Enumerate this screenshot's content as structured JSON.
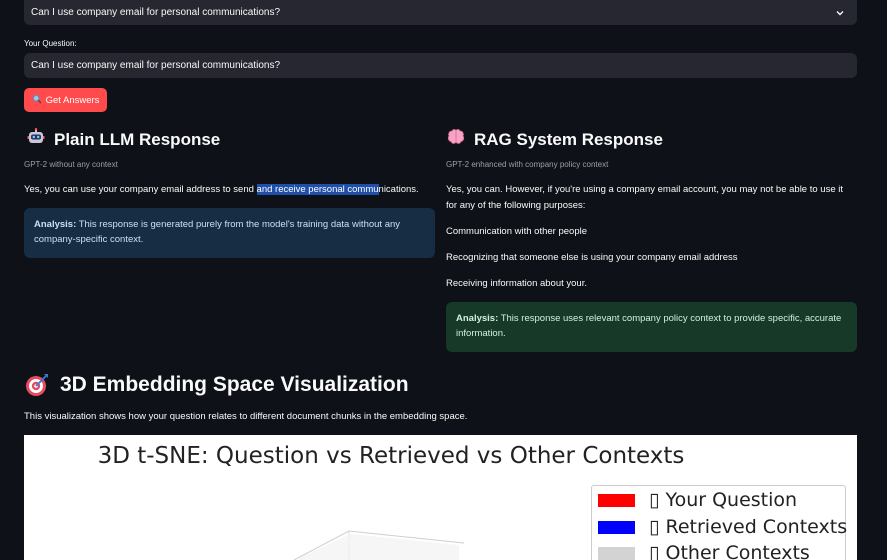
{
  "dropdown": {
    "selected": "Can I use company email for personal communications?"
  },
  "question": {
    "label": "Your Question:",
    "value": "Can I use company email for personal communications?"
  },
  "button": {
    "label": "Get Answers"
  },
  "plain": {
    "title": "Plain LLM Response",
    "caption": "GPT-2 without any context",
    "text_before": "Yes, you can use your company email address to send ",
    "text_highlight": "and receive personal commu",
    "text_after": "nications.",
    "analysis_label": "Analysis:",
    "analysis_text": " This response is generated purely from the model's training data without any company-specific context."
  },
  "rag": {
    "title": "RAG System Response",
    "caption": "GPT-2 enhanced with company policy context",
    "para1": "Yes, you can. However, if you're using a company email account, you may not be able to use it for any of the following purposes:",
    "para2": "Communication with other people",
    "para3": "Recognizing that someone else is using your company email address",
    "para4": "Receiving information about your.",
    "analysis_label": "Analysis:",
    "analysis_text": " This response uses relevant company policy context to provide specific, accurate information."
  },
  "section": {
    "title": "3D Embedding Space Visualization",
    "description": "This visualization shows how your question relates to different document chunks in the embedding space."
  },
  "chart_data": {
    "type": "scatter",
    "title": "3D t-SNE: Question vs Retrieved vs Other Contexts",
    "legend_position": "top-right",
    "series": [
      {
        "name": "Your Question",
        "color": "#ff0000",
        "prefix": "▯"
      },
      {
        "name": "Retrieved Contexts",
        "color": "#0000ff",
        "prefix": "▯"
      },
      {
        "name": "Other Contexts",
        "color": "#d3d3d3",
        "prefix": "▯"
      }
    ]
  },
  "colors": {
    "background": "#0e1117",
    "input_bg": "#262730",
    "button": "#ff4b4b",
    "analysis_blue": "#172d43",
    "analysis_green": "#173928"
  },
  "icons": {
    "dropdown": "chevron-down-icon",
    "button": "magnifier-icon",
    "plain": "robot-icon",
    "rag": "brain-icon",
    "section": "target-icon"
  }
}
